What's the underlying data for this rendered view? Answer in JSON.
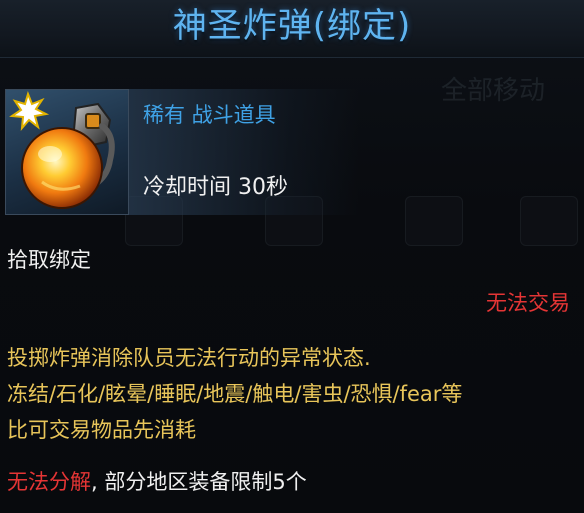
{
  "item": {
    "title": "神圣炸弹(绑定)",
    "rarity": "稀有 战斗道具",
    "cooldown": "冷却时间 30秒",
    "bind_type": "拾取绑定",
    "trade_status": "无法交易",
    "description_lines": [
      "投掷炸弹消除队员无法行动的异常状态.",
      "冻结/石化/眩晕/睡眠/地震/触电/害虫/恐惧/fear等",
      "比可交易物品先消耗"
    ],
    "footer_warning": "无法分解",
    "footer_text": ", 部分地区装备限制5个",
    "icon": "holy-bomb-grenade-icon"
  },
  "background": {
    "ghost_text": "全部移动"
  },
  "colors": {
    "title": "#5fb4f0",
    "rarity": "#3fa2e6",
    "warning": "#e53535",
    "description": "#e8c55a",
    "text": "#f0f0f0"
  }
}
